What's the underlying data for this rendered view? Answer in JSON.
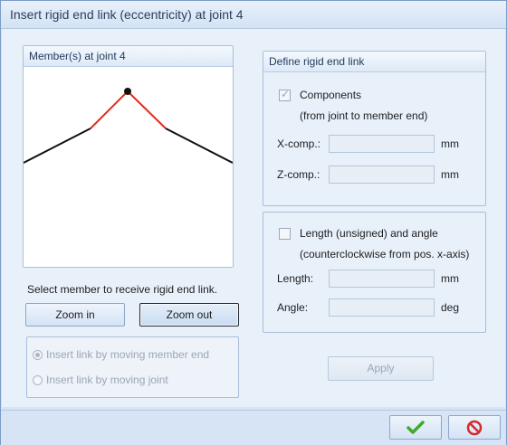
{
  "window": {
    "title": "Insert rigid end link (eccentricity) at joint 4"
  },
  "members_panel": {
    "title": "Member(s) at joint 4"
  },
  "select_hint": "Select member to receive rigid end link.",
  "buttons": {
    "zoom_in": "Zoom in",
    "zoom_out": "Zoom out",
    "apply": "Apply"
  },
  "insert_mode": {
    "options": [
      "Insert link by moving member end",
      "Insert link by moving joint"
    ],
    "selected": "Insert link by moving member end"
  },
  "define_panel": {
    "title": "Define rigid end link",
    "components_label": "Components",
    "components_sub": "(from joint to member end)",
    "components_checked": true,
    "xcomp_label": "X-comp.:",
    "xcomp_value": "",
    "xcomp_unit": "mm",
    "zcomp_label": "Z-comp.:",
    "zcomp_value": "",
    "zcomp_unit": "mm"
  },
  "length_panel": {
    "label": "Length (unsigned) and angle",
    "sub": "(counterclockwise from pos. x-axis)",
    "checked": false,
    "length_label": "Length:",
    "length_value": "",
    "length_unit": "mm",
    "angle_label": "Angle:",
    "angle_value": "",
    "angle_unit": "deg"
  },
  "footer_icons": {
    "ok": "checkmark-icon",
    "cancel": "cancel-icon"
  },
  "colors": {
    "selected_member": "#e8261f",
    "member": "#111111",
    "ok_green": "#3faa2e",
    "cancel_red": "#d42a2a"
  }
}
